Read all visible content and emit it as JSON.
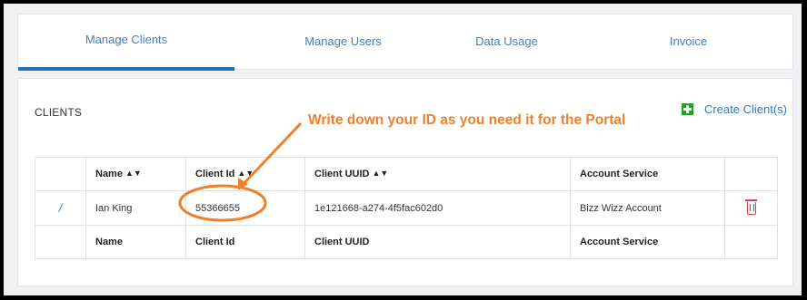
{
  "tabs": [
    {
      "label": "Manage Clients",
      "active": true
    },
    {
      "label": "Manage Users",
      "active": false
    },
    {
      "label": "Data Usage",
      "active": false
    },
    {
      "label": "Invoice",
      "active": false
    }
  ],
  "clients": {
    "title": "CLIENTS",
    "create_button_label": "Create Client(s)",
    "annotation": "Write down your ID as you need it for the Portal",
    "columns": [
      "Name",
      "Client Id",
      "Client UUID",
      "Account Service"
    ],
    "row": {
      "name": "Ian King",
      "client_id": "55366655",
      "client_uuid": "1e121668-a274-4f5fac602d0",
      "account_service": "Bizz Wizz Account"
    },
    "footer_columns": [
      "Name",
      "Client Id",
      "Client UUID",
      "Account Service"
    ]
  },
  "colors": {
    "accent": "#2a70a8",
    "link": "#3f7fc0",
    "annotation": "#f07f2a",
    "delete": "#d9404a",
    "add": "#2a9a2a"
  },
  "icons": [
    "sort-icon",
    "pencil-icon",
    "trash-icon",
    "plus-icon"
  ]
}
